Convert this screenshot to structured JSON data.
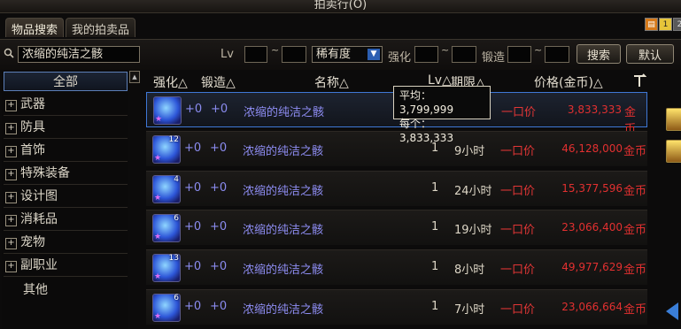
{
  "window": {
    "title": "拍卖行(O)"
  },
  "tabs": [
    {
      "label": "物品搜索",
      "active": true
    },
    {
      "label": "我的拍卖品",
      "active": false
    }
  ],
  "search": {
    "name_value": "浓缩的纯洁之骸",
    "lv_label": "Lv",
    "rarity_select": "稀有度",
    "enhance_label": "强化",
    "forge_label": "锻造",
    "tilde": "~",
    "search_button": "搜索",
    "default_button": "默认"
  },
  "categories": [
    {
      "label": "全部",
      "expandable": false,
      "selected": true
    },
    {
      "label": "武器",
      "expandable": true
    },
    {
      "label": "防具",
      "expandable": true
    },
    {
      "label": "首饰",
      "expandable": true
    },
    {
      "label": "特殊装备",
      "expandable": true
    },
    {
      "label": "设计图",
      "expandable": true
    },
    {
      "label": "消耗品",
      "expandable": true
    },
    {
      "label": "宠物",
      "expandable": true
    },
    {
      "label": "副职业",
      "expandable": true
    },
    {
      "label": "其他",
      "expandable": false
    }
  ],
  "columns": {
    "enhance": "强化△",
    "forge": "锻造△",
    "name": "名称△",
    "lv": "Lv△",
    "period": "期限△",
    "price": "价格(金币)△"
  },
  "tooltip": {
    "avg": "平均：3,799,999",
    "each": "每个：3,833,333"
  },
  "rows": [
    {
      "count": "",
      "enhance": "+0",
      "forge": "+0",
      "name": "浓缩的纯洁之骸",
      "lv": "",
      "period": "",
      "buy": "一口价",
      "price": "3,833,333",
      "unit": "金币",
      "selected": true
    },
    {
      "count": "12",
      "enhance": "+0",
      "forge": "+0",
      "name": "浓缩的纯洁之骸",
      "lv": "1",
      "period": "9小时",
      "buy": "一口价",
      "price": "46,128,000",
      "unit": "金币"
    },
    {
      "count": "4",
      "enhance": "+0",
      "forge": "+0",
      "name": "浓缩的纯洁之骸",
      "lv": "1",
      "period": "24小时",
      "buy": "一口价",
      "price": "15,377,596",
      "unit": "金币"
    },
    {
      "count": "6",
      "enhance": "+0",
      "forge": "+0",
      "name": "浓缩的纯洁之骸",
      "lv": "1",
      "period": "19小时",
      "buy": "一口价",
      "price": "23,066,400",
      "unit": "金币"
    },
    {
      "count": "13",
      "enhance": "+0",
      "forge": "+0",
      "name": "浓缩的纯洁之骸",
      "lv": "1",
      "period": "8小时",
      "buy": "一口价",
      "price": "49,977,629",
      "unit": "金币"
    },
    {
      "count": "6",
      "enhance": "+0",
      "forge": "+0",
      "name": "浓缩的纯洁之骸",
      "lv": "1",
      "period": "7小时",
      "buy": "一口价",
      "price": "23,066,664",
      "unit": "金币"
    }
  ],
  "colors": {
    "accent": "#3f78d6",
    "price": "#e23030",
    "name": "#8e8df3"
  }
}
